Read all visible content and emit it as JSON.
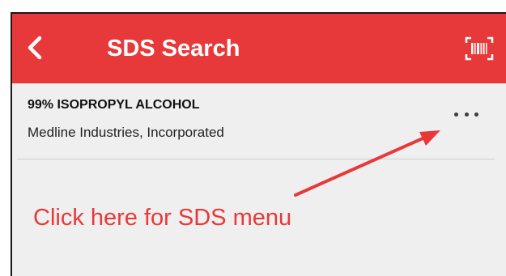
{
  "appbar": {
    "title": "SDS Search",
    "back_icon": "chevron-left-icon",
    "scan_icon": "barcode-scan-icon",
    "color": "#e8393a"
  },
  "result": {
    "product_name": "99% ISOPROPYL ALCOHOL",
    "manufacturer": "Medline Industries, Incorporated",
    "menu_icon": "more-horizontal-icon"
  },
  "annotation": {
    "callout_text": "Click here for SDS menu",
    "color": "#e8393a"
  }
}
